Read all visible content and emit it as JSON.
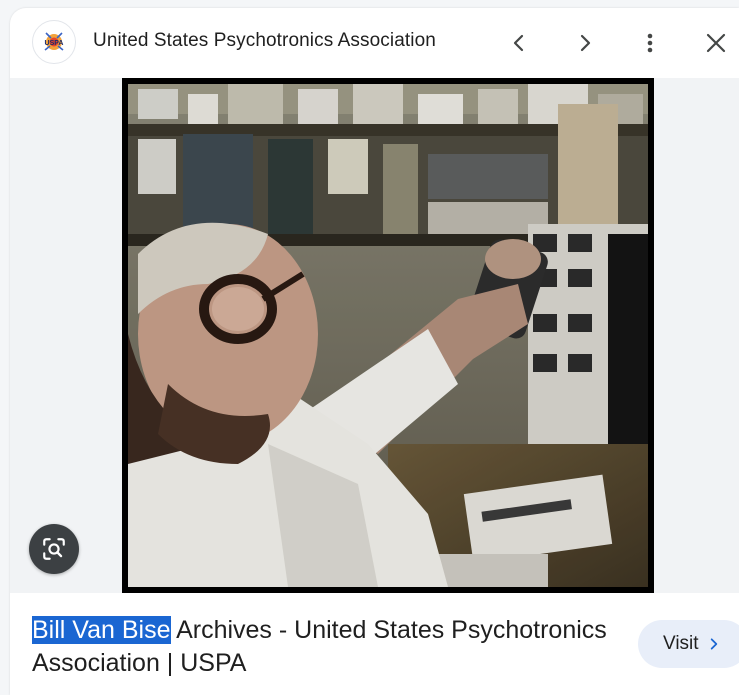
{
  "header": {
    "site_icon": "uspa-logo-icon",
    "site_icon_text": "USPA",
    "site_name": "United States Psychotronics Association",
    "prev_icon": "chevron-left-icon",
    "next_icon": "chevron-right-icon",
    "more_icon": "more-vert-icon",
    "close_icon": "close-icon"
  },
  "image": {
    "lens_icon": "lens-search-icon"
  },
  "caption": {
    "highlighted": "Bill Van Bise",
    "rest": " Archives - United States Psychotronics Association | USPA"
  },
  "visit": {
    "label": "Visit",
    "icon": "chevron-right-icon"
  },
  "colors": {
    "highlight_bg": "#1a66d2",
    "visit_bg": "#e8eef9",
    "visit_chevron": "#1a66d2",
    "lens_bg": "#3c4043"
  }
}
